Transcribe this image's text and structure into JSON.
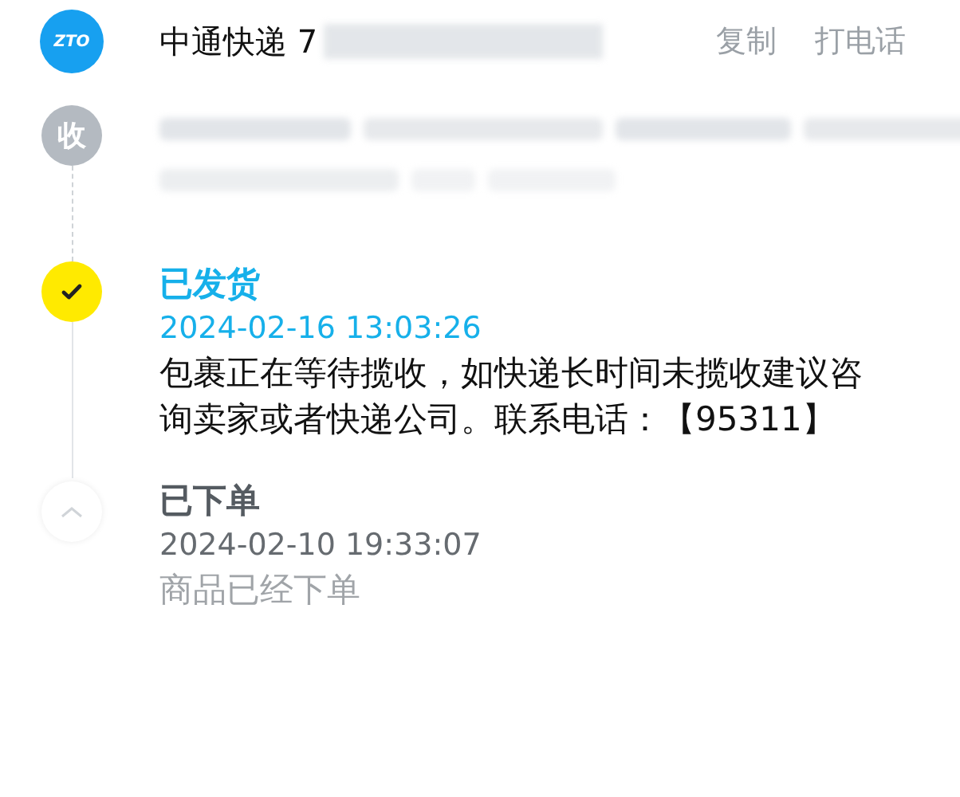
{
  "header": {
    "logo_text": "ZTO",
    "title": "中通快递 7",
    "actions": [
      "复制",
      "打电话"
    ]
  },
  "recipient": {
    "badge": "收"
  },
  "events": [
    {
      "kind": "check",
      "current": true,
      "status": "已发货",
      "time": "2024-02-16 13:03:26",
      "detail": "包裹正在等待揽收，如快递长时间未揽收建议咨询卖家或者快递公司。联系电话：【95311】"
    },
    {
      "kind": "collapse",
      "current": false,
      "status": "已下单",
      "time": "2024-02-10 19:33:07",
      "detail": "商品已经下单"
    }
  ]
}
